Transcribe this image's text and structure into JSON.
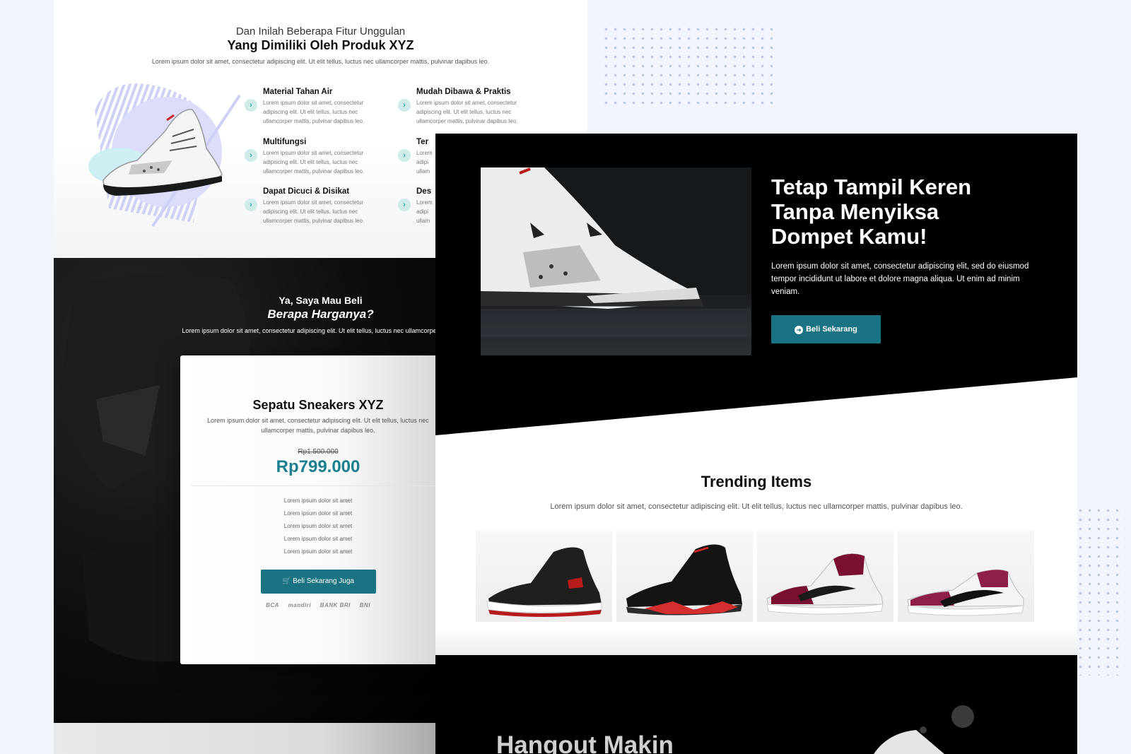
{
  "features": {
    "kicker": "Dan Inilah Beberapa Fitur Unggulan",
    "title": "Yang Dimiliki Oleh Produk XYZ",
    "subtitle": "Lorem ipsum dolor sit amet, consectetur adipiscing elit. Ut elit tellus, luctus nec ullamcorper mattis, pulvinar dapibus leo.",
    "items": [
      {
        "name": "Material Tahan Air",
        "text": "Lorem ipsum dolor sit amet, consectetur adipiscing elit. Ut elit tellus, luctus nec ullamcorper mattis, pulvinar dapibus leo."
      },
      {
        "name": "Mudah Dibawa & Praktis",
        "text": "Lorem ipsum dolor sit amet, consectetur adipiscing elit. Ut elit tellus, luctus nec ullamcorper mattis, pulvinar dapibus leo."
      },
      {
        "name": "Multifungsi",
        "text": "Lorem ipsum dolor sit amet, consectetur adipiscing elit. Ut elit tellus, luctus nec ullamcorper mattis, pulvinar dapibus leo."
      },
      {
        "name": "Ter",
        "text": "Lorem adipi ullam"
      },
      {
        "name": "Dapat Dicuci & Disikat",
        "text": "Lorem ipsum dolor sit amet, consectetur adipiscing elit. Ut elit tellus, luctus nec ullamcorper mattis, pulvinar dapibus leo."
      },
      {
        "name": "Des",
        "text": "Lorem adipi ullam"
      }
    ]
  },
  "price": {
    "kicker": "Ya, Saya Mau Beli",
    "title": "Berapa Harganya?",
    "subtitle": "Lorem ipsum dolor sit amet, consectetur adipiscing elit. Ut elit tellus, luctus nec ullamcorper mattis,",
    "card": {
      "title": "Sepatu Sneakers XYZ",
      "desc": "Lorem ipsum dolor sit amet, consectetur adipiscing elit. Ut elit tellus, luctus nec ullamcorper mattis, pulvinar dapibus leo.",
      "old_price": "Rp1.500.000",
      "new_price": "Rp799.000",
      "list": [
        "Lorem ipsum dolor sit amet",
        "Lorem ipsum dolor sit amet",
        "Lorem ipsum dolor sit amet",
        "Lorem ipsum dolor sit amet",
        "Lorem ipsum dolor sit amet"
      ],
      "button": "Beli Sekarang Juga",
      "banks": [
        "BCA",
        "mandiri",
        "BANK BRI",
        "BNI"
      ]
    }
  },
  "hero": {
    "title_line1": "Tetap Tampil Keren",
    "title_line2": "Tanpa Menyiksa",
    "title_line3": "Dompet Kamu!",
    "text": "Lorem ipsum dolor sit amet, consectetur adipiscing elit, sed do eiusmod tempor incididunt ut labore et dolore magna aliqua. Ut enim ad minim veniam.",
    "button": "Beli Sekarang"
  },
  "trending": {
    "title": "Trending Items",
    "subtitle": "Lorem ipsum dolor sit amet, consectetur adipiscing elit. Ut elit tellus, luctus nec ullamcorper mattis, pulvinar dapibus leo."
  },
  "hangout": {
    "title": "Hangout Makin"
  },
  "colors": {
    "accent": "#1a7383",
    "price": "#1a7f8e",
    "check": "#2aa6a0",
    "dots": "#b9c6e4"
  },
  "icons": [
    "check-icon",
    "arrow-right-circle-icon",
    "cart-icon",
    "sneaker-image"
  ]
}
